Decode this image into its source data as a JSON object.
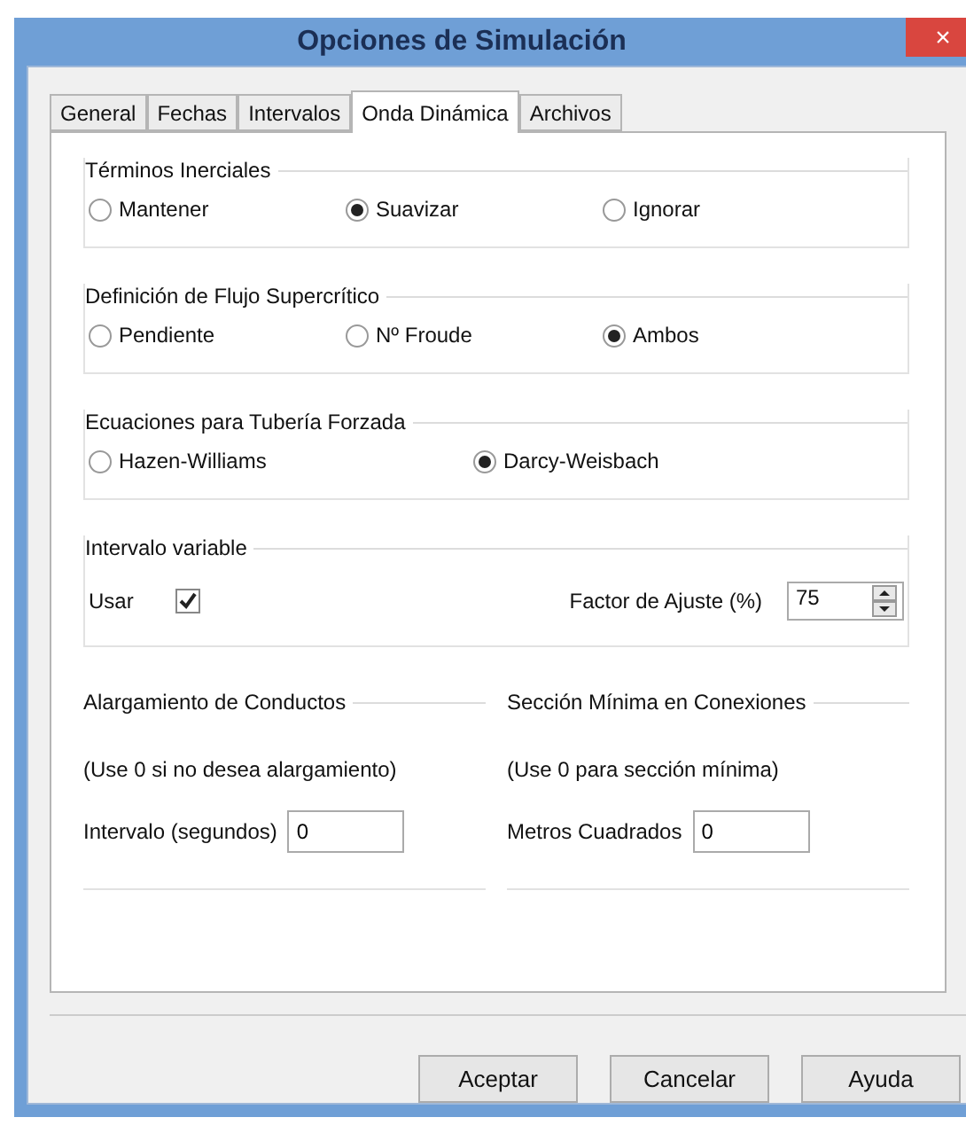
{
  "window": {
    "title": "Opciones de Simulación",
    "close": "×"
  },
  "tabs": [
    {
      "label": "General",
      "selected": false
    },
    {
      "label": "Fechas",
      "selected": false
    },
    {
      "label": "Intervalos",
      "selected": false
    },
    {
      "label": "Onda Dinámica",
      "selected": true
    },
    {
      "label": "Archivos",
      "selected": false
    }
  ],
  "radio_groups": [
    {
      "title": "Términos Inerciales",
      "options": [
        {
          "label": "Mantener",
          "selected": false
        },
        {
          "label": "Suavizar",
          "selected": true
        },
        {
          "label": "Ignorar",
          "selected": false
        }
      ]
    },
    {
      "title": "Definición de Flujo Supercrítico",
      "options": [
        {
          "label": "Pendiente",
          "selected": false
        },
        {
          "label": "Nº Froude",
          "selected": false
        },
        {
          "label": "Ambos",
          "selected": true
        }
      ]
    },
    {
      "title": "Ecuaciones para Tubería Forzada",
      "options": [
        {
          "label": "Hazen-Williams",
          "selected": false
        },
        {
          "label": "Darcy-Weisbach",
          "selected": true
        }
      ]
    }
  ],
  "variable_step": {
    "title": "Intervalo variable",
    "use_label": "Usar",
    "use_checked": true,
    "factor_label": "Factor de Ajuste (%)",
    "factor_value": "75"
  },
  "bottom_groups": [
    {
      "title": "Alargamiento de Conductos",
      "hint": "(Use 0 si no desea alargamiento)",
      "field_label": "Intervalo (segundos)",
      "field_value": "0"
    },
    {
      "title": "Sección Mínima en Conexiones",
      "hint": "(Use 0 para sección mínima)",
      "field_label": "Metros Cuadrados",
      "field_value": "0"
    }
  ],
  "buttons": [
    "Aceptar",
    "Cancelar",
    "Ayuda"
  ]
}
